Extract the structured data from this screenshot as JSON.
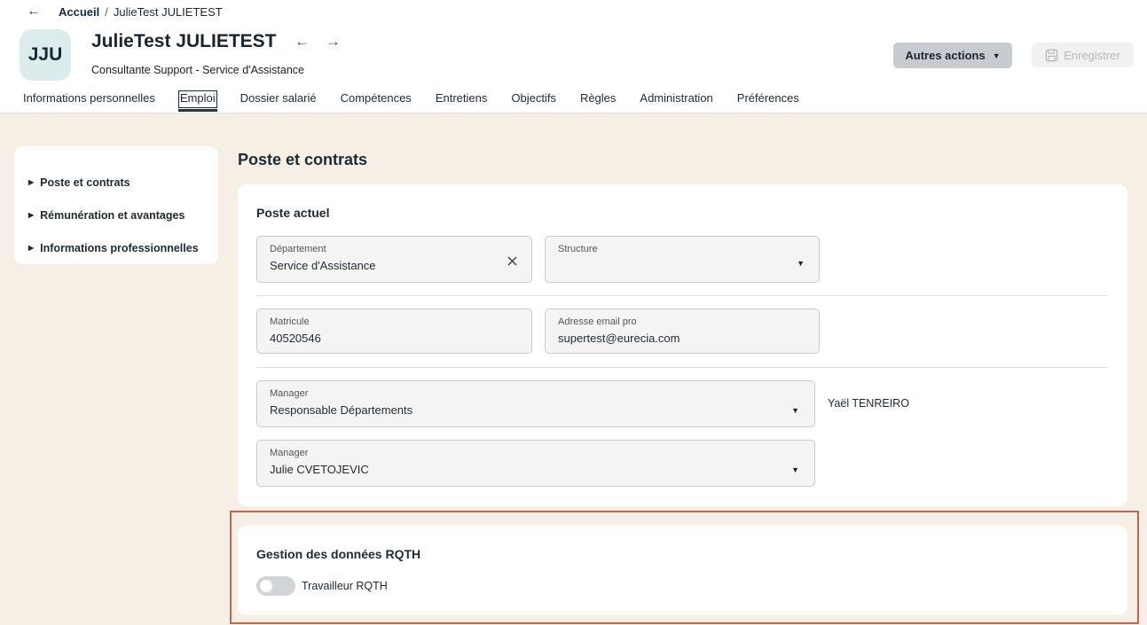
{
  "breadcrumb": {
    "back": "←",
    "home": "Accueil",
    "separator": "/",
    "current": "JulieTest JULIETEST"
  },
  "profile": {
    "initials": "JJU",
    "name": "JulieTest JULIETEST",
    "prev_arrow": "←",
    "next_arrow": "→",
    "subtitle": "Consultante Support - Service d'Assistance"
  },
  "actions": {
    "more_label": "Autres actions",
    "save_label": "Enregistrer"
  },
  "tabs": [
    {
      "label": "Informations personnelles"
    },
    {
      "label": "Emploi",
      "active": true
    },
    {
      "label": "Dossier salarié"
    },
    {
      "label": "Compétences"
    },
    {
      "label": "Entretiens"
    },
    {
      "label": "Objectifs"
    },
    {
      "label": "Règles"
    },
    {
      "label": "Administration"
    },
    {
      "label": "Préférences"
    }
  ],
  "sidebar": {
    "items": [
      {
        "label": "Poste et contrats"
      },
      {
        "label": "Rémunération et avantages"
      },
      {
        "label": "Informations professionnelles"
      }
    ]
  },
  "section_title": "Poste et contrats",
  "poste": {
    "title": "Poste actuel",
    "departement": {
      "label": "Département",
      "value": "Service d'Assistance"
    },
    "structure": {
      "label": "Structure",
      "value": ""
    },
    "matricule": {
      "label": "Matricule",
      "value": "40520546"
    },
    "email": {
      "label": "Adresse email pro",
      "value": "supertest@eurecia.com"
    },
    "manager1": {
      "label": "Manager",
      "value": "Responsable Départements",
      "aside": "Yaël TENREIRO"
    },
    "manager2": {
      "label": "Manager",
      "value": "Julie CVETOJEVIC"
    }
  },
  "rqth": {
    "title": "Gestion des données RQTH",
    "toggle_label": "Travailleur RQTH",
    "enabled": false
  },
  "colors": {
    "highlight_border": "#c9654a",
    "page_bg": "#f5efe6",
    "avatar_bg": "#dcebeb"
  }
}
